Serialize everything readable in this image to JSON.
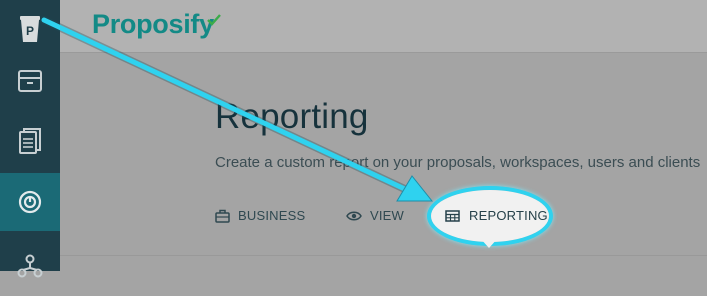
{
  "app": {
    "logo_text": "Proposify",
    "brand_color": "#138a86",
    "sidebar_color": "#1f3f4a",
    "sidebar_active_color": "#1b6a76",
    "highlight_color": "#2fd2ef"
  },
  "sidebar": {
    "items": [
      {
        "icon": "proposify-p-logo-icon"
      },
      {
        "icon": "archive-box-icon"
      },
      {
        "icon": "documents-icon"
      },
      {
        "icon": "power-icon",
        "active": true
      },
      {
        "icon": "integrations-icon"
      }
    ]
  },
  "page": {
    "title": "Reporting",
    "subtitle": "Create a custom report on your proposals, workspaces, users and clients"
  },
  "tabs": [
    {
      "label": "BUSINESS",
      "icon": "briefcase-icon"
    },
    {
      "label": "VIEW",
      "icon": "eye-icon"
    },
    {
      "label": "REPORTING",
      "icon": "table-icon",
      "active": true
    }
  ]
}
